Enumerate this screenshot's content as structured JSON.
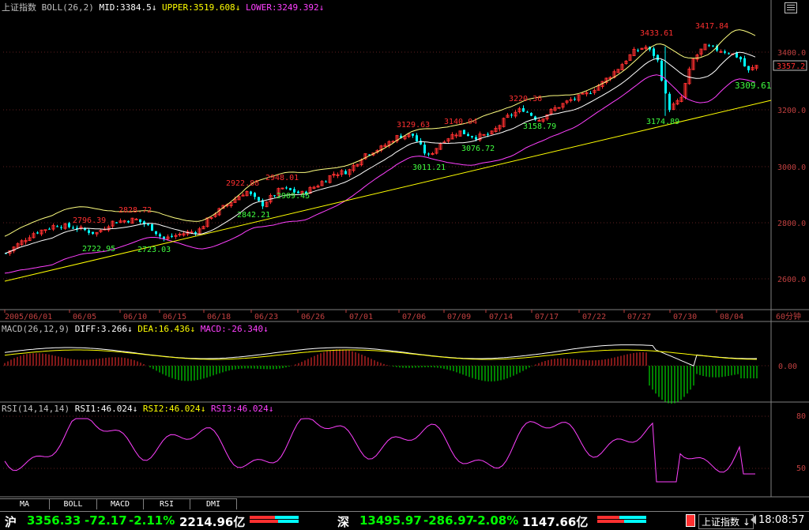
{
  "main_panel": {
    "indicator_name": "上证指数",
    "indicator": "BOLL(26,2)",
    "mid": "MID:3384.5",
    "upper": "UPPER:3519.608",
    "lower": "LOWER:3249.392",
    "price_axis": [
      "3400.0",
      "3200.0",
      "3000.0",
      "2800.0",
      "2600.0"
    ],
    "current_price_tag": "3357.2",
    "annotations": [
      {
        "text": "2796.39",
        "color": "#ff3030"
      },
      {
        "text": "2828.72",
        "color": "#ff3030"
      },
      {
        "text": "2722.95",
        "color": "#40ff40"
      },
      {
        "text": "2723.03",
        "color": "#40ff40"
      },
      {
        "text": "2922.88",
        "color": "#ff3030"
      },
      {
        "text": "2948.01",
        "color": "#ff3030"
      },
      {
        "text": "2842.21",
        "color": "#40ff40"
      },
      {
        "text": "2909.45",
        "color": "#40ff40"
      },
      {
        "text": "3129.63",
        "color": "#ff3030"
      },
      {
        "text": "3140.04",
        "color": "#ff3030"
      },
      {
        "text": "3011.21",
        "color": "#40ff40"
      },
      {
        "text": "3076.72",
        "color": "#40ff40"
      },
      {
        "text": "3220.36",
        "color": "#ff3030"
      },
      {
        "text": "3158.79",
        "color": "#40ff40"
      },
      {
        "text": "3433.61",
        "color": "#ff3030"
      },
      {
        "text": "3417.84",
        "color": "#ff3030"
      },
      {
        "text": "3174.89",
        "color": "#40ff40"
      },
      {
        "text": "3309.61",
        "color": "#40ff40"
      }
    ],
    "date_axis": [
      "2005/06/01",
      "06/05",
      "06/10",
      "06/15",
      "06/18",
      "06/23",
      "06/26",
      "07/01",
      "07/06",
      "07/09",
      "07/14",
      "07/17",
      "07/22",
      "07/27",
      "07/30",
      "08/04"
    ],
    "period_label": "60分钟"
  },
  "macd_panel": {
    "indicator": "MACD(26,12,9)",
    "diff": "DIFF:3.266",
    "dea": "DEA:16.436",
    "macd": "MACD:-26.340",
    "axis_label": "0.00"
  },
  "rsi_panel": {
    "indicator": "RSI(14,14,14)",
    "rsi1": "RSI1:46.024",
    "rsi2": "RSI2:46.024",
    "rsi3": "RSI3:46.024",
    "axis_labels": [
      "80",
      "50"
    ]
  },
  "tabs": [
    "MA",
    "BOLL",
    "MACD",
    "RSI",
    "DMI"
  ],
  "status_bar": {
    "sh_label": "沪",
    "sh_price": "3356.33",
    "sh_change": "-72.17",
    "sh_pct": "-2.11%",
    "sh_volume": "2214.96亿",
    "sz_label": "深",
    "sz_price": "13495.97",
    "sz_change": "-286.97",
    "sz_pct": "-2.08%",
    "sz_volume": "1147.66亿",
    "index_selector": "上证指数",
    "time": "18:08:57"
  },
  "colors": {
    "up": "#ff3030",
    "down": "#00ffff",
    "mid_line": "#ffffff",
    "upper_line": "#ffff80",
    "lower_line": "#ff40ff",
    "trend_line": "#ffff00"
  }
}
